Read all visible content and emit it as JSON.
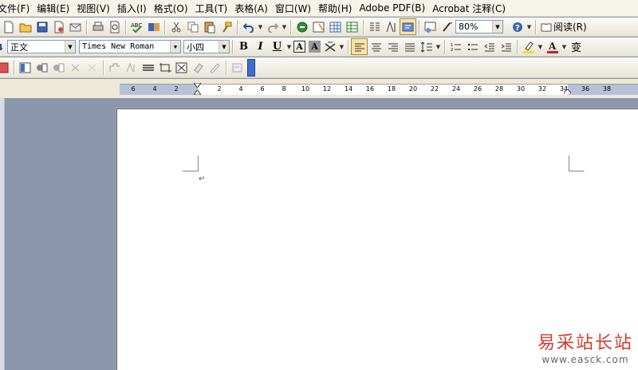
{
  "menubar": {
    "items": [
      "文件(F)",
      "编辑(E)",
      "视图(V)",
      "插入(I)",
      "格式(O)",
      "工具(T)",
      "表格(A)",
      "窗口(W)",
      "帮助(H)",
      "Adobe PDF(B)",
      "Acrobat 注释(C)"
    ]
  },
  "standard_toolbar": {
    "zoom_value": "80%",
    "read_label": "阅读(R)"
  },
  "formatting_toolbar": {
    "style_value": "正文",
    "font_value": "Times New Roman",
    "size_value": "小四",
    "bold_label": "B",
    "italic_label": "I",
    "underline_label": "U",
    "char_border_label": "A",
    "char_shading_label": "A",
    "phonetic_label": "变"
  },
  "ruler": {
    "labels": [
      "6",
      "4",
      "2",
      "2",
      "4",
      "6",
      "8",
      "10",
      "12",
      "14",
      "16",
      "18",
      "20",
      "22",
      "24",
      "26",
      "28",
      "30",
      "32",
      "34",
      "36",
      "38"
    ]
  },
  "document": {
    "paragraph_mark": "↵"
  },
  "watermark": {
    "logo": "易采站长站",
    "url": "www.easck.com"
  },
  "colors": {
    "highlight": "#f5e01a",
    "font_color": "#d01c1c",
    "watermark_red": "#d63a2a"
  }
}
